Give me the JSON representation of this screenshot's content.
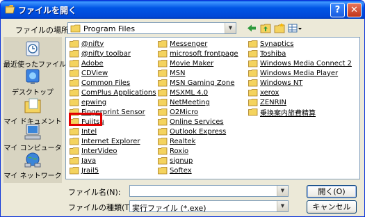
{
  "window": {
    "title": "ファイルを開く",
    "help_label": "?",
    "close_label": "✕"
  },
  "toolbar": {
    "lookin_label": "ファイルの場所(I):",
    "lookin_value": "Program Files"
  },
  "places": [
    {
      "label": "最近使ったファイル",
      "icon": "recent-icon"
    },
    {
      "label": "デスクトップ",
      "icon": "desktop-icon"
    },
    {
      "label": "マイ ドキュメント",
      "icon": "my-documents-icon"
    },
    {
      "label": "マイ コンピュータ",
      "icon": "my-computer-icon"
    },
    {
      "label": "マイ ネットワーク",
      "icon": "my-network-icon"
    }
  ],
  "folders": [
    "@nifty",
    "@nifty toolbar",
    "Adobe",
    "CDView",
    "Common Files",
    "ComPlus Applications",
    "epwing",
    "Fingerprint Sensor",
    "Fujitsu",
    "Intel",
    "Internet Explorer",
    "InterVideo",
    "Java",
    "Jrail5",
    "Messenger",
    "microsoft frontpage",
    "Movie Maker",
    "MSN",
    "MSN Gaming Zone",
    "MSXML 4.0",
    "NetMeeting",
    "O2Micro",
    "Online Services",
    "Outlook Express",
    "Realtek",
    "Roxio",
    "signup",
    "Softex",
    "Synaptics",
    "Toshiba",
    "Windows Media Connect 2",
    "Windows Media Player",
    "Windows NT",
    "xerox",
    "ZENRIN",
    "乗換案内旅費精算"
  ],
  "filename": {
    "label": "ファイル名(N):",
    "value": ""
  },
  "filetype": {
    "label": "ファイルの種類(T):",
    "value": "実行ファイル (*.exe)"
  },
  "buttons": {
    "open": "開く(O)",
    "cancel": "キャンセル"
  },
  "colors": {
    "titlebar": "#0055e5",
    "dialog_bg": "#ece9d8",
    "places_bg": "#d8d4c1",
    "highlight": "#e30000",
    "folder": "#f4d35e"
  }
}
